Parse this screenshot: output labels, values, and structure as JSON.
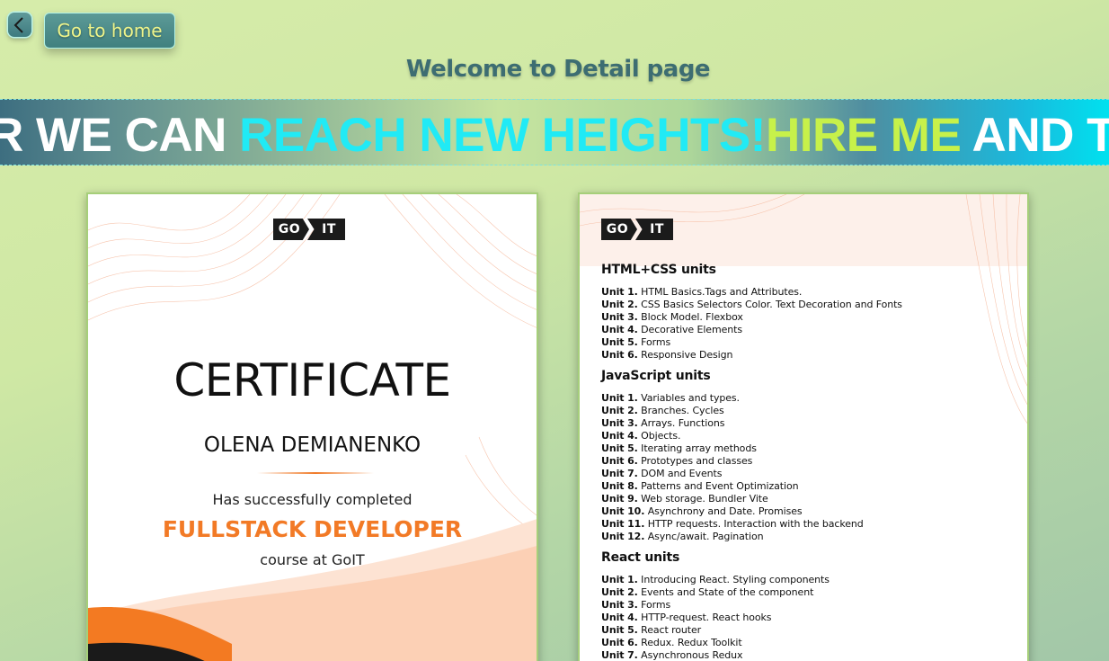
{
  "nav": {
    "back_icon": "chevron-left-icon",
    "home_label": "Go to home"
  },
  "page": {
    "title": "Welcome to Detail page"
  },
  "marquee": {
    "segments": [
      {
        "text": "R WE CAN ",
        "color": "#ffffff"
      },
      {
        "text": "REACH NEW HEIGHTS!",
        "color": "#21eaf5"
      },
      {
        "text": "HIRE ME",
        "color": "#c7f14a"
      },
      {
        "text": " AND TOG",
        "color": "#ffffff"
      }
    ]
  },
  "certificate": {
    "logo_left": "GO",
    "logo_right": "IT",
    "title": "CERTIFICATE",
    "name": "OLENA DEMIANENKO",
    "completed_text": "Has successfully completed",
    "course": "FULLSTACK DEVELOPER",
    "course_suffix": "course at GoIT",
    "accent_color": "#f27a26"
  },
  "syllabus": {
    "logo_left": "GO",
    "logo_right": "IT",
    "groups": [
      {
        "heading": "HTML+CSS units",
        "units": [
          {
            "label": "Unit 1.",
            "text": "HTML Basics.Tags and Attributes."
          },
          {
            "label": "Unit 2.",
            "text": "CSS Basics Selectors Color. Text Decoration and Fonts"
          },
          {
            "label": "Unit 3.",
            "text": "Block Model. Flexbox"
          },
          {
            "label": "Unit 4.",
            "text": "Decorative Elements"
          },
          {
            "label": "Unit 5.",
            "text": "Forms"
          },
          {
            "label": "Unit 6.",
            "text": "Responsive Design"
          }
        ]
      },
      {
        "heading": "JavaScript units",
        "units": [
          {
            "label": "Unit 1.",
            "text": "Variables and types."
          },
          {
            "label": "Unit 2.",
            "text": "Branches. Cycles"
          },
          {
            "label": "Unit 3.",
            "text": "Arrays. Functions"
          },
          {
            "label": "Unit 4.",
            "text": "Objects."
          },
          {
            "label": "Unit 5.",
            "text": "Iterating array methods"
          },
          {
            "label": "Unit 6.",
            "text": "Prototypes and classes"
          },
          {
            "label": "Unit 7.",
            "text": "DOM and Events"
          },
          {
            "label": "Unit 8.",
            "text": "Patterns and Event Optimization"
          },
          {
            "label": "Unit 9.",
            "text": "Web storage. Bundler Vite"
          },
          {
            "label": "Unit 10.",
            "text": "Asynchrony and Date. Promises"
          },
          {
            "label": "Unit 11.",
            "text": "HTTP requests. Interaction with the backend"
          },
          {
            "label": "Unit 12.",
            "text": "Async/await. Pagination"
          }
        ]
      },
      {
        "heading": "React units",
        "units": [
          {
            "label": "Unit 1.",
            "text": "Introducing React. Styling components"
          },
          {
            "label": "Unit 2.",
            "text": "Events and State of the component"
          },
          {
            "label": "Unit 3.",
            "text": "Forms"
          },
          {
            "label": "Unit 4.",
            "text": "HTTP-request. React hooks"
          },
          {
            "label": "Unit 5.",
            "text": "React router"
          },
          {
            "label": "Unit 6.",
            "text": "Redux. Redux Toolkit"
          },
          {
            "label": "Unit 7.",
            "text": "Asynchronous Redux"
          }
        ]
      }
    ]
  }
}
